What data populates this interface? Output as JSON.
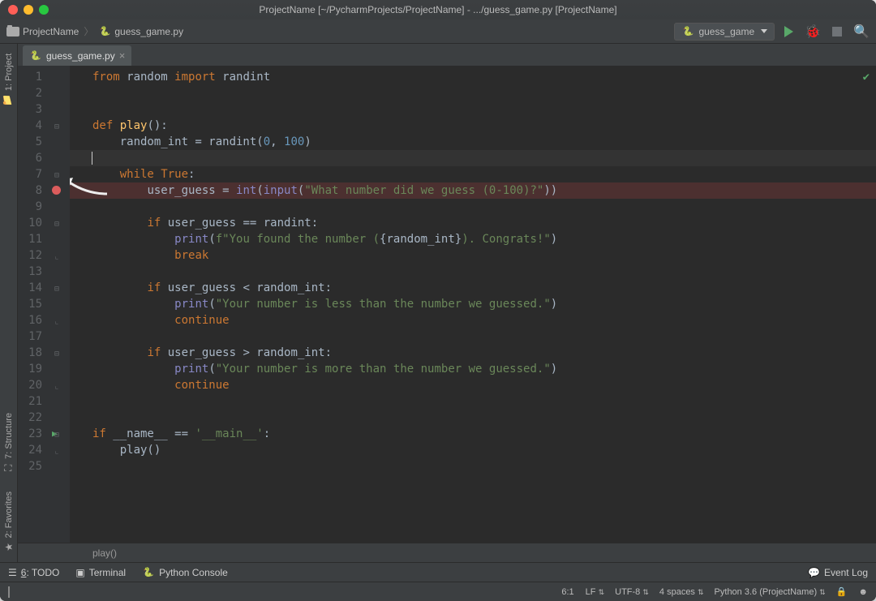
{
  "titlebar": {
    "title": "ProjectName [~/PycharmProjects/ProjectName] - .../guess_game.py [ProjectName]"
  },
  "breadcrumb": {
    "project": "ProjectName",
    "file": "guess_game.py"
  },
  "run_config": {
    "label": "guess_game"
  },
  "left_tool_windows": {
    "project": "1: Project",
    "structure": "7: Structure",
    "favorites": "2: Favorites"
  },
  "tab": {
    "filename": "guess_game.py"
  },
  "editor": {
    "line_count": 25,
    "breakpoint_line": 8,
    "caret_line": 6,
    "run_gutter_line": 23,
    "lines": {
      "1": {
        "pre": "",
        "tokens": [
          [
            "kw",
            "from"
          ],
          [
            "op",
            " random "
          ],
          [
            "kw",
            "import"
          ],
          [
            "op",
            " randint"
          ]
        ]
      },
      "2": {
        "pre": "",
        "tokens": []
      },
      "3": {
        "pre": "",
        "tokens": []
      },
      "4": {
        "pre": "",
        "tokens": [
          [
            "kw",
            "def "
          ],
          [
            "fn",
            "play"
          ],
          [
            "op",
            "():"
          ]
        ]
      },
      "5": {
        "pre": "    ",
        "tokens": [
          [
            "op",
            "random_int = randint("
          ],
          [
            "num",
            "0"
          ],
          [
            "op",
            ", "
          ],
          [
            "num",
            "100"
          ],
          [
            "op",
            ")"
          ]
        ]
      },
      "6": {
        "pre": "    ",
        "tokens": []
      },
      "7": {
        "pre": "    ",
        "tokens": [
          [
            "kw",
            "while "
          ],
          [
            "kw",
            "True"
          ],
          [
            "op",
            ":"
          ]
        ]
      },
      "8": {
        "pre": "        ",
        "tokens": [
          [
            "op",
            "user_guess = "
          ],
          [
            "builtin",
            "int"
          ],
          [
            "op",
            "("
          ],
          [
            "builtin",
            "input"
          ],
          [
            "op",
            "("
          ],
          [
            "str",
            "\"What number did we guess (0-100)?\""
          ],
          [
            "op",
            "))"
          ]
        ]
      },
      "9": {
        "pre": "",
        "tokens": []
      },
      "10": {
        "pre": "        ",
        "tokens": [
          [
            "kw",
            "if"
          ],
          [
            "op",
            " user_guess == randint:"
          ]
        ]
      },
      "11": {
        "pre": "            ",
        "tokens": [
          [
            "builtin",
            "print"
          ],
          [
            "op",
            "("
          ],
          [
            "str",
            "f\"You found the number ("
          ],
          [
            "op",
            "{random_int}"
          ],
          [
            "str",
            "). Congrats!\""
          ],
          [
            "op",
            ")"
          ]
        ]
      },
      "12": {
        "pre": "            ",
        "tokens": [
          [
            "kw",
            "break"
          ]
        ]
      },
      "13": {
        "pre": "",
        "tokens": []
      },
      "14": {
        "pre": "        ",
        "tokens": [
          [
            "kw",
            "if"
          ],
          [
            "op",
            " user_guess < random_int:"
          ]
        ]
      },
      "15": {
        "pre": "            ",
        "tokens": [
          [
            "builtin",
            "print"
          ],
          [
            "op",
            "("
          ],
          [
            "str",
            "\"Your number is less than the number we guessed.\""
          ],
          [
            "op",
            ")"
          ]
        ]
      },
      "16": {
        "pre": "            ",
        "tokens": [
          [
            "kw",
            "continue"
          ]
        ]
      },
      "17": {
        "pre": "",
        "tokens": []
      },
      "18": {
        "pre": "        ",
        "tokens": [
          [
            "kw",
            "if"
          ],
          [
            "op",
            " user_guess > random_int:"
          ]
        ]
      },
      "19": {
        "pre": "            ",
        "tokens": [
          [
            "builtin",
            "print"
          ],
          [
            "op",
            "("
          ],
          [
            "str",
            "\"Your number is more than the number we guessed.\""
          ],
          [
            "op",
            ")"
          ]
        ]
      },
      "20": {
        "pre": "            ",
        "tokens": [
          [
            "kw",
            "continue"
          ]
        ]
      },
      "21": {
        "pre": "",
        "tokens": []
      },
      "22": {
        "pre": "",
        "tokens": []
      },
      "23": {
        "pre": "",
        "tokens": [
          [
            "kw",
            "if"
          ],
          [
            "op",
            " __name__ == "
          ],
          [
            "str",
            "'__main__'"
          ],
          [
            "op",
            ":"
          ]
        ]
      },
      "24": {
        "pre": "    ",
        "tokens": [
          [
            "op",
            "play()"
          ]
        ]
      },
      "25": {
        "pre": "",
        "tokens": []
      }
    },
    "crumb": "play()"
  },
  "bottom_tool_windows": {
    "todo": "6: TODO",
    "terminal": "Terminal",
    "python_console": "Python Console",
    "event_log": "Event Log"
  },
  "status_bar": {
    "position": "6:1",
    "line_sep": "LF",
    "encoding": "UTF-8",
    "indent": "4 spaces",
    "interpreter": "Python 3.6 (ProjectName)"
  }
}
